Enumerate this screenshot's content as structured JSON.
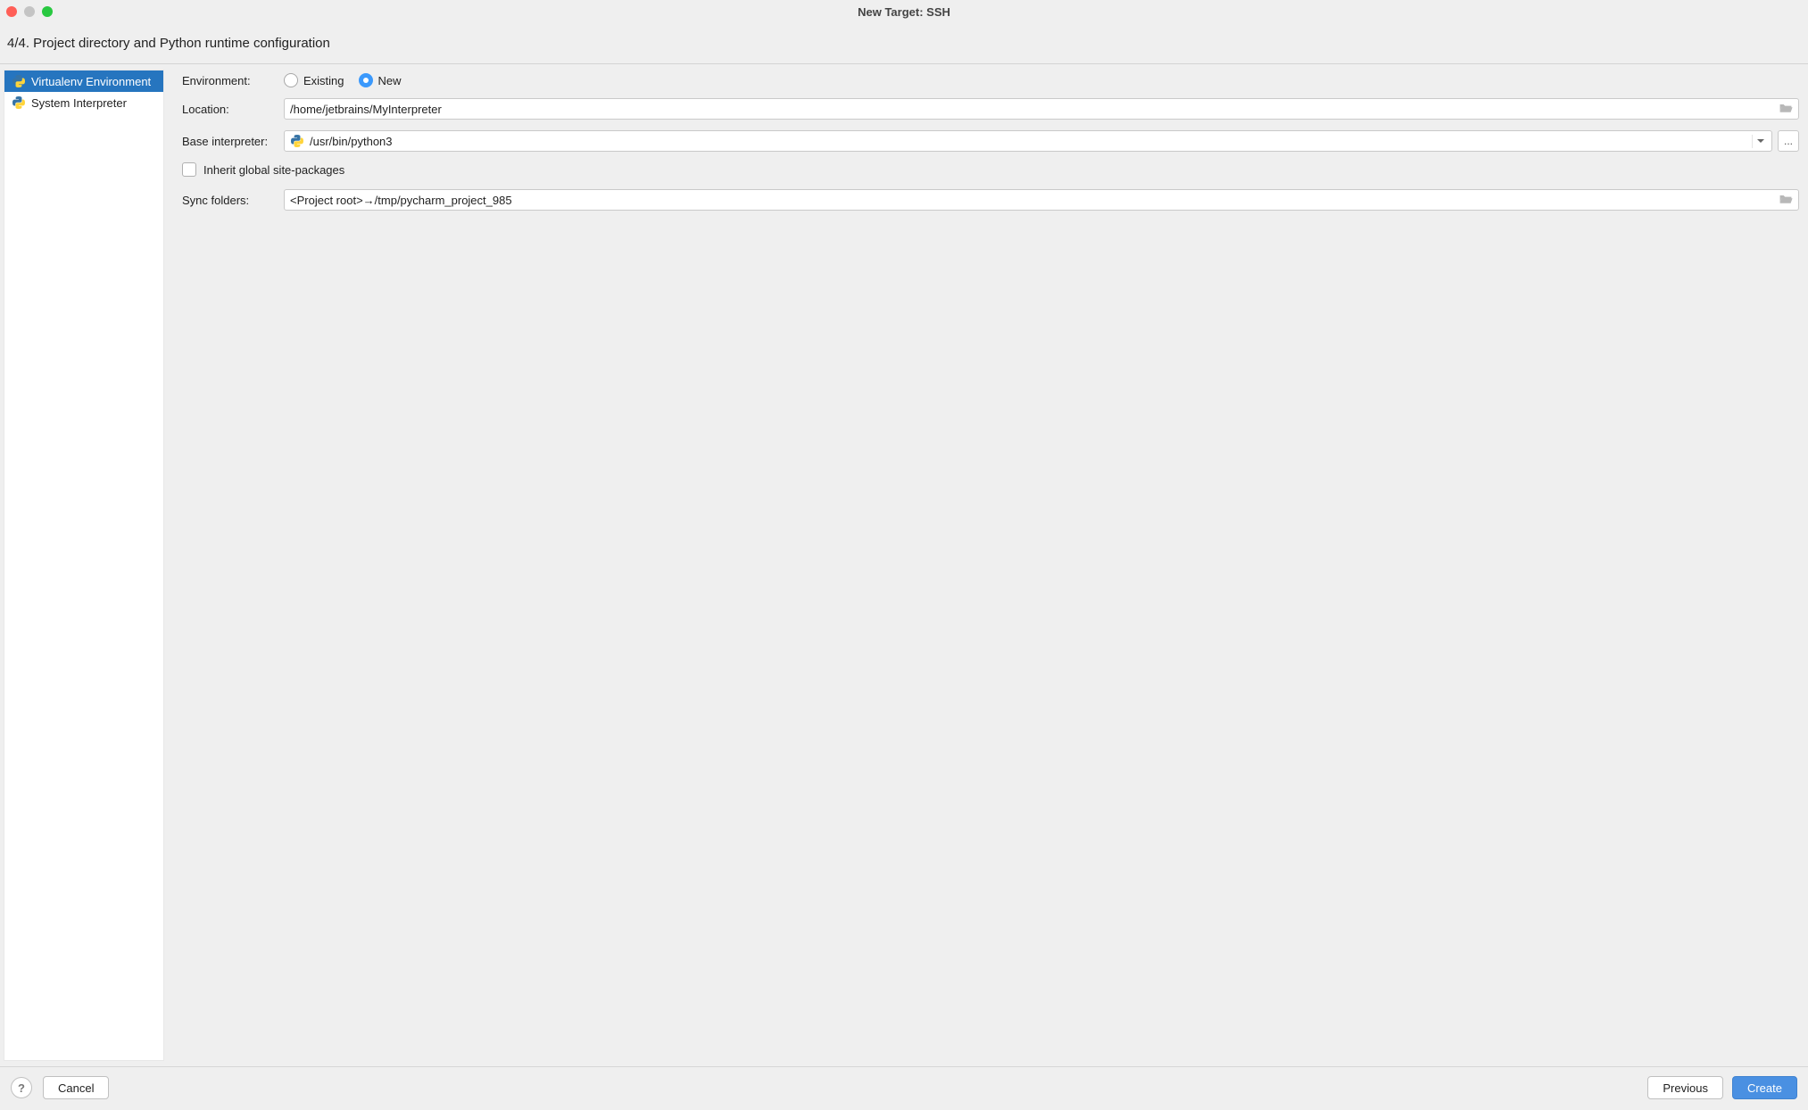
{
  "window": {
    "title": "New Target: SSH"
  },
  "step": {
    "label": "4/4. Project directory and Python runtime configuration"
  },
  "sidebar": {
    "items": [
      {
        "label": "Virtualenv Environment",
        "selected": true
      },
      {
        "label": "System Interpreter",
        "selected": false
      }
    ]
  },
  "form": {
    "environment": {
      "label": "Environment:",
      "options": {
        "existing": "Existing",
        "new": "New"
      },
      "selected": "new"
    },
    "location": {
      "label": "Location:",
      "value": "/home/jetbrains/MyInterpreter"
    },
    "base_interpreter": {
      "label": "Base interpreter:",
      "value": "/usr/bin/python3",
      "browse_label": "..."
    },
    "inherit_global": {
      "label": "Inherit global site-packages",
      "checked": false
    },
    "sync_folders": {
      "label": "Sync folders:",
      "value": "<Project root>→/tmp/pycharm_project_985"
    }
  },
  "buttons": {
    "help": "?",
    "cancel": "Cancel",
    "previous": "Previous",
    "create": "Create"
  }
}
